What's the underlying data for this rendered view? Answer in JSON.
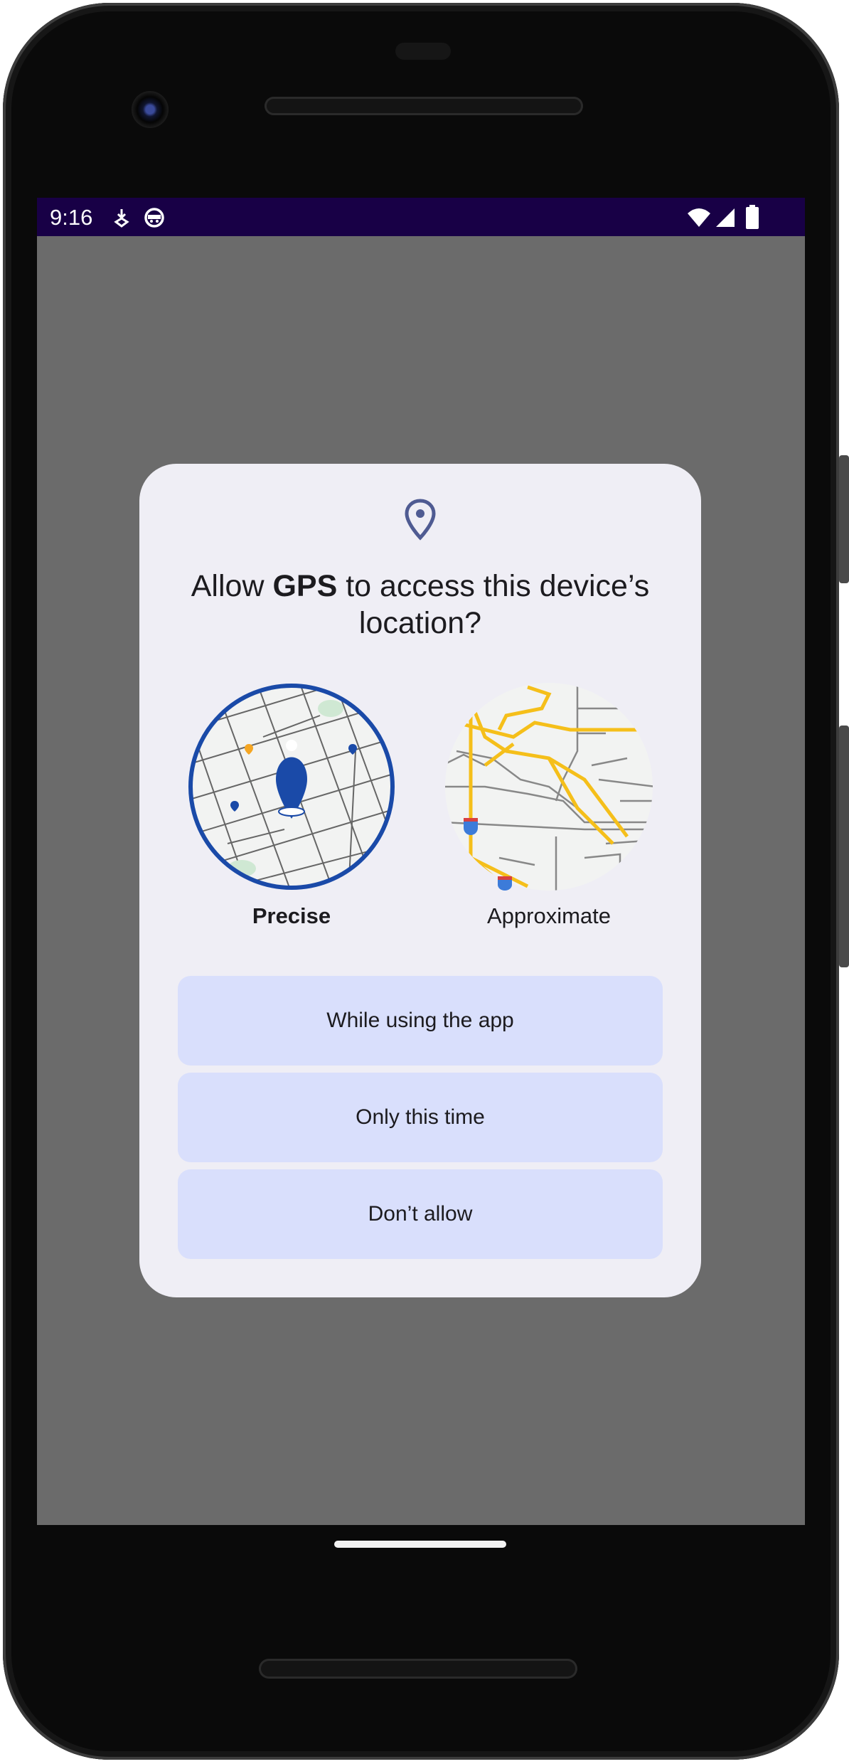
{
  "status_bar": {
    "time": "9:16",
    "icons": [
      "download-notification-icon",
      "android-robot-icon",
      "wifi-icon",
      "cellular-signal-icon",
      "battery-icon"
    ]
  },
  "dialog": {
    "icon": "location-pin-icon",
    "title_prefix": "Allow ",
    "app_name": "GPS",
    "title_suffix": " to access this device’s location?",
    "options": [
      {
        "label": "Precise",
        "selected": true,
        "icon": "precise-map-icon"
      },
      {
        "label": "Approximate",
        "selected": false,
        "icon": "approximate-map-icon"
      }
    ],
    "buttons": [
      "While using the app",
      "Only this time",
      "Don’t allow"
    ]
  },
  "colors": {
    "status_bar": "#180046",
    "scrim": "#6b6b6b",
    "dialog_bg": "#efeef5",
    "button_bg": "#d9dffc",
    "accent_blue": "#1a4aa8",
    "road_yellow": "#f5bf1a"
  }
}
